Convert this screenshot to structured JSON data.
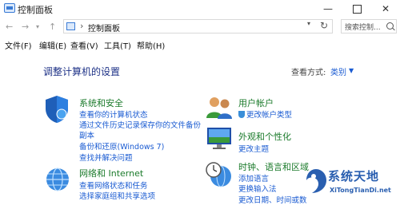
{
  "window": {
    "title": "控制面板",
    "minimize": "—",
    "close": "✕"
  },
  "nav": {
    "back": "←",
    "forward": "→",
    "dropdown": "▾",
    "up": "↑"
  },
  "address": {
    "separator": "›",
    "path": "控制面板",
    "dropdown": "▾",
    "refresh": "↻"
  },
  "search": {
    "placeholder": "搜索控制..."
  },
  "menu": [
    {
      "label": "文件(F)"
    },
    {
      "label": "编辑(E)"
    },
    {
      "label": "查看(V)"
    },
    {
      "label": "工具(T)"
    },
    {
      "label": "帮助(H)"
    }
  ],
  "page": {
    "heading": "调整计算机的设置",
    "view_by_label": "查看方式:",
    "view_by_value": "类别",
    "view_by_arrow": "▼"
  },
  "categories": [
    {
      "title": "系统和安全",
      "icon": "shield-icon",
      "links": [
        "查看你的计算机状态",
        "通过文件历史记录保存你的文件备份",
        "副本",
        "备份和还原(Windows 7)",
        "查找并解决问题"
      ]
    },
    {
      "title": "网络和 Internet",
      "icon": "globe-network-icon",
      "links": [
        "查看网络状态和任务",
        "选择家庭组和共享选项"
      ]
    },
    {
      "title": "用户帐户",
      "icon": "users-icon",
      "links": [
        "更改帐户类型"
      ]
    },
    {
      "title": "外观和个性化",
      "icon": "monitor-icon",
      "links": [
        "更改主题"
      ]
    },
    {
      "title": "时钟、语言和区域",
      "icon": "clock-globe-icon",
      "links": [
        "添加语言",
        "更换输入法",
        "更改日期、时间或数"
      ]
    }
  ],
  "watermark": {
    "text": "系统天地",
    "url": "XiTongTianDi.net"
  },
  "colors": {
    "category_title": "#1a7a2a",
    "link": "#1a5bd2",
    "heading": "#1e3287"
  }
}
